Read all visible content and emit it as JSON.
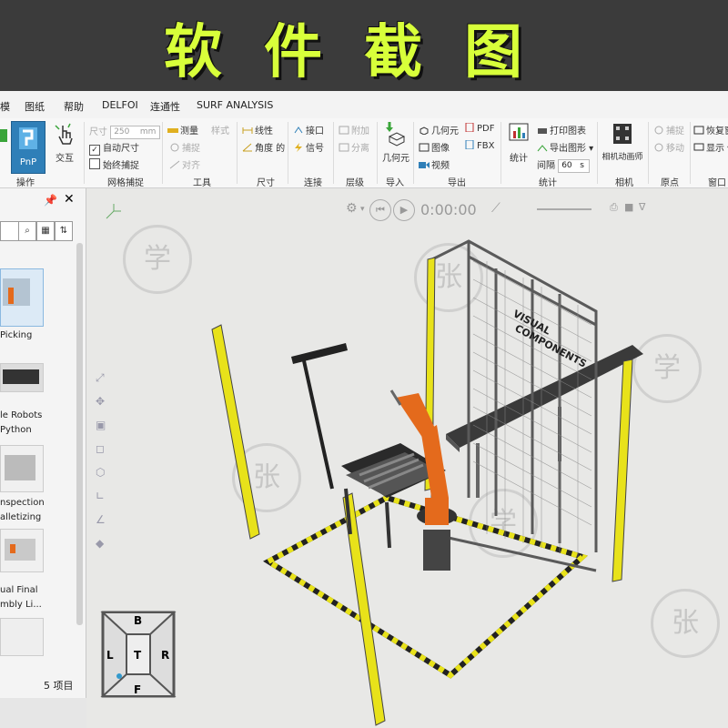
{
  "banner": {
    "title": "软件截图"
  },
  "menu": {
    "items": [
      "模",
      "图纸",
      "帮助",
      "DELFOI",
      "连通性",
      "SURF ANALYSIS"
    ]
  },
  "ribbon": {
    "operate": {
      "pnp": "PnP",
      "interact": "交互",
      "label": "操作"
    },
    "grid": {
      "size_label": "尺寸",
      "size_value": "250",
      "size_unit": "mm",
      "auto_size": "自动尺寸",
      "always_snap": "始终捕捉",
      "label": "网格捕捉"
    },
    "tools": {
      "measure": "测量",
      "style": "样式",
      "snap": "捕捉",
      "align": "对齐",
      "label": "工具"
    },
    "dimension": {
      "linear": "线性",
      "angle": "角度 的",
      "label": "尺寸"
    },
    "connect": {
      "interface": "接口",
      "signal": "信号",
      "label": "连接"
    },
    "layers": {
      "attach": "附加",
      "detach": "分离",
      "label": "层级"
    },
    "import": {
      "geometry": "几何元",
      "label": "导入"
    },
    "export": {
      "geometry": "几何元",
      "pdf": "PDF",
      "image": "图像",
      "fbx": "FBX",
      "video": "视频",
      "label": "导出"
    },
    "stats": {
      "stats": "统计",
      "print_chart": "打印图表",
      "export_chart": "导出图形",
      "interval_label": "间隔",
      "interval_value": "60",
      "interval_unit": "s",
      "label": "统计"
    },
    "camera": {
      "animator": "相机动画师",
      "label": "相机"
    },
    "origin": {
      "capture": "捕捉",
      "move": "移动",
      "label": "原点"
    },
    "window": {
      "restore": "恢复窗",
      "display": "显示",
      "label": "窗口"
    }
  },
  "sidebar": {
    "pin_icon": "pin-icon",
    "close_icon": "close-icon",
    "items": [
      {
        "label1": "Picking",
        "label2": ""
      },
      {
        "label1": "le Robots",
        "label2": "Python"
      },
      {
        "label1": "nspection",
        "label2": "alletizing"
      },
      {
        "label1": "ual Final",
        "label2": "mbly Li..."
      }
    ],
    "footer": "5 项目"
  },
  "playback": {
    "time": "0:00:00"
  },
  "scene": {
    "brand_line1": "VISUAL",
    "brand_line2": "COMPONENTS"
  },
  "navcube": {
    "top": "B",
    "left": "L",
    "center": "T",
    "right": "R",
    "bottom": "F"
  },
  "colors": {
    "banner_bg": "#3b3b3b",
    "banner_text": "#d8ff3a",
    "robot": "#e46a1c",
    "safety_yellow": "#e8e21a",
    "accent": "#2f7fb8"
  }
}
